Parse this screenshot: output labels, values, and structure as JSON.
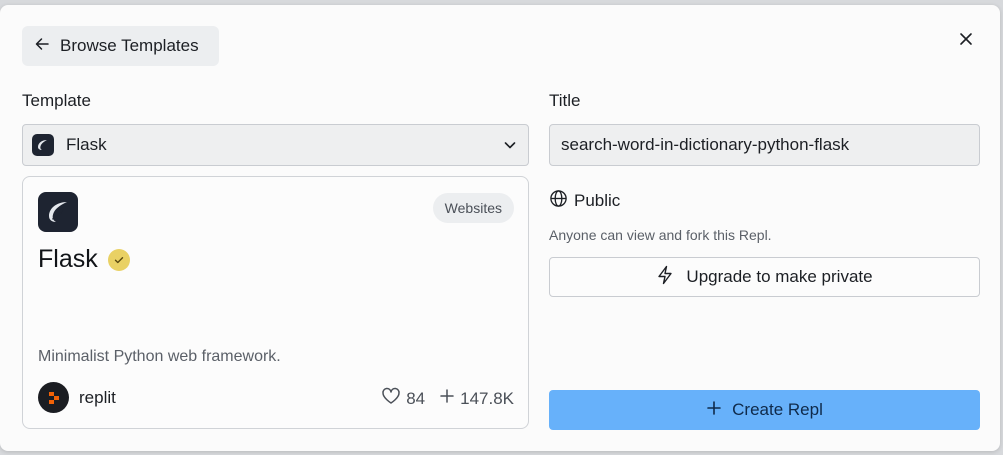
{
  "header": {
    "back_label": "Browse Templates"
  },
  "template": {
    "label": "Template",
    "selected": "Flask"
  },
  "card": {
    "category": "Websites",
    "name": "Flask",
    "description": "Minimalist Python web framework.",
    "author": "replit",
    "likes": "84",
    "forks": "147.8K"
  },
  "title_field": {
    "label": "Title",
    "value": "search-word-in-dictionary-python-flask"
  },
  "visibility": {
    "label": "Public",
    "hint": "Anyone can view and fork this Repl."
  },
  "actions": {
    "upgrade_label": "Upgrade to make private",
    "create_label": "Create Repl"
  },
  "colors": {
    "create_button": "#67b1fa",
    "verified_badge": "#e9d164",
    "logo_bg": "#1e2431"
  }
}
